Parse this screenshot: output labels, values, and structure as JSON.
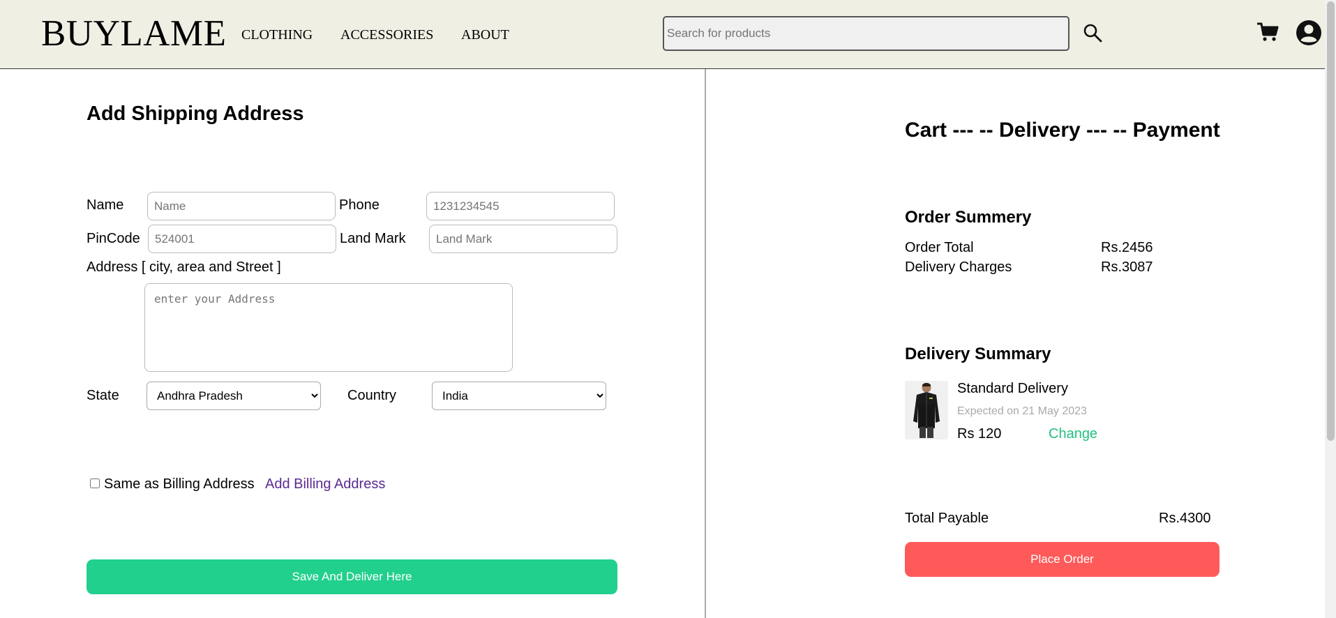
{
  "header": {
    "logo": "BUYLAME",
    "nav": [
      "CLOTHING",
      "ACCESSORIES",
      "ABOUT"
    ],
    "search_placeholder": "Search for products",
    "icons": [
      "search-icon",
      "cart-icon",
      "user-icon"
    ]
  },
  "form": {
    "title": "Add Shipping Address",
    "name_label": "Name",
    "name_placeholder": "Name",
    "phone_label": "Phone",
    "phone_placeholder": "1231234545",
    "pincode_label": "PinCode",
    "pincode_placeholder": "524001",
    "landmark_label": "Land Mark",
    "landmark_placeholder": "Land Mark",
    "address_label": "Address [ city, area and Street ]",
    "address_placeholder": "enter your Address",
    "state_label": "State",
    "state_value": "Andhra Pradesh",
    "country_label": "Country",
    "country_value": "India",
    "same_billing_label": "Same as Billing Address",
    "add_billing_link": "Add Billing Address",
    "save_button": "Save And Deliver Here"
  },
  "summary": {
    "steps": "Cart --- -- Delivery --- -- Payment",
    "order_title": "Order Summery",
    "order_total_label": "Order Total",
    "order_total_value": "Rs.2456",
    "delivery_charges_label": "Delivery Charges",
    "delivery_charges_value": "Rs.3087",
    "delivery_title": "Delivery Summary",
    "delivery_type": "Standard Delivery",
    "expected": "Expected on 21 May 2023",
    "delivery_price": "Rs 120",
    "change_link": "Change",
    "total_payable_label": "Total Payable",
    "total_payable_value": "Rs.4300",
    "place_order_button": "Place Order"
  },
  "colors": {
    "header_bg": "#efefe4",
    "save_button": "#22d08e",
    "place_order_button": "#ff5a5a",
    "change_link": "#22c07e",
    "billing_link": "#5b2a91"
  }
}
